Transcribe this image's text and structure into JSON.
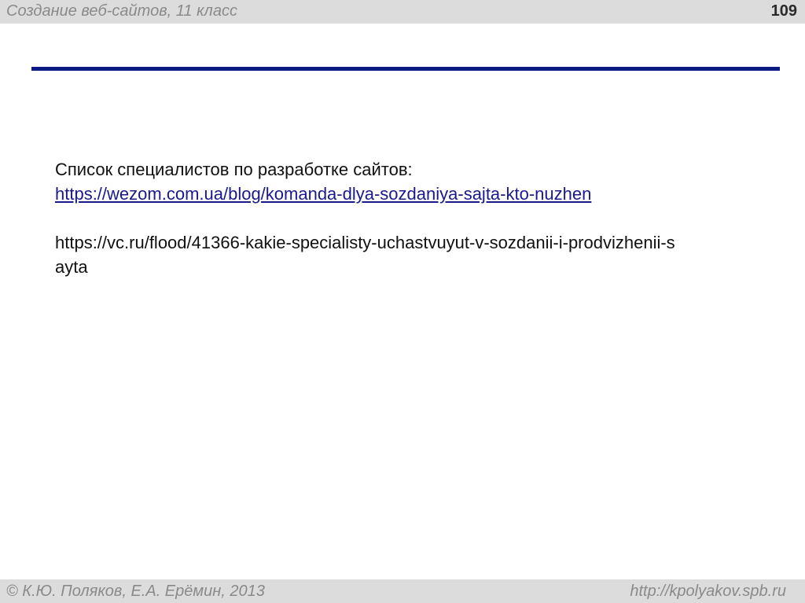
{
  "header": {
    "title": "Создание веб-сайтов, 11 класс",
    "page_number": "109"
  },
  "colors": {
    "rule": "#0b1a84",
    "header_bg": "#dcdcdc",
    "muted_text": "#8a8a8a"
  },
  "content": {
    "heading": "Список специалистов по разработке сайтов:",
    "link1": "https://wezom.com.ua/blog/komanda-dlya-sozdaniya-sajta-kto-nuzhen",
    "link2": " https://vc.ru/flood/41366-kakie-specialisty-uchastvuyut-v-sozdanii-i-prodvizhenii-sayta"
  },
  "footer": {
    "copyright": "© К.Ю. Поляков, Е.А. Ерёмин, 2013",
    "site": "http://kpolyakov.spb.ru"
  }
}
